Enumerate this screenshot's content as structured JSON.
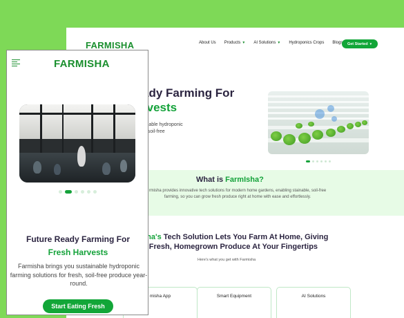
{
  "desktop": {
    "logo": "FARMISHA",
    "nav": {
      "about": "About Us",
      "products": "Products",
      "ai_solutions": "AI Solutions",
      "hydroponics": "Hydroponics Crops",
      "blogs": "Blogs",
      "cta": "Get Started"
    },
    "hero": {
      "title_line1": "ady Farming For",
      "title_line2": "rvests",
      "sub_line1": "ainable hydroponic",
      "sub_line2": "n, soil-free"
    },
    "what": {
      "title_prefix": "What is ",
      "title_brand": "FarmIsha?",
      "text": "rmisha provides innovative tech solutions for modern home gardens, enabling stainable, soil-free farming, so you can grow fresh produce right at home with ease and effortlessly."
    },
    "tech": {
      "line1_brand": "sha's",
      "line1_rest": " Tech Solution Lets You Farm At Home, Giving",
      "line2": "u Fresh, Homegrown Produce At Your Fingertips",
      "sub": "Here's what you get with Farmisha"
    },
    "cards": [
      "misha App",
      "Smart Equipment",
      "AI Solutions"
    ]
  },
  "mobile": {
    "logo": "FARMISHA",
    "title_line1": "Future Ready Farming For",
    "title_line2": "Fresh Harvests",
    "text": "Farmisha brings you sustainable hydroponic farming solutions for fresh, soil-free produce year-round.",
    "cta": "Start Eating Fresh"
  },
  "colors": {
    "brand_green": "#14a23a",
    "background": "#7ed957",
    "dark_text": "#2b2440"
  }
}
